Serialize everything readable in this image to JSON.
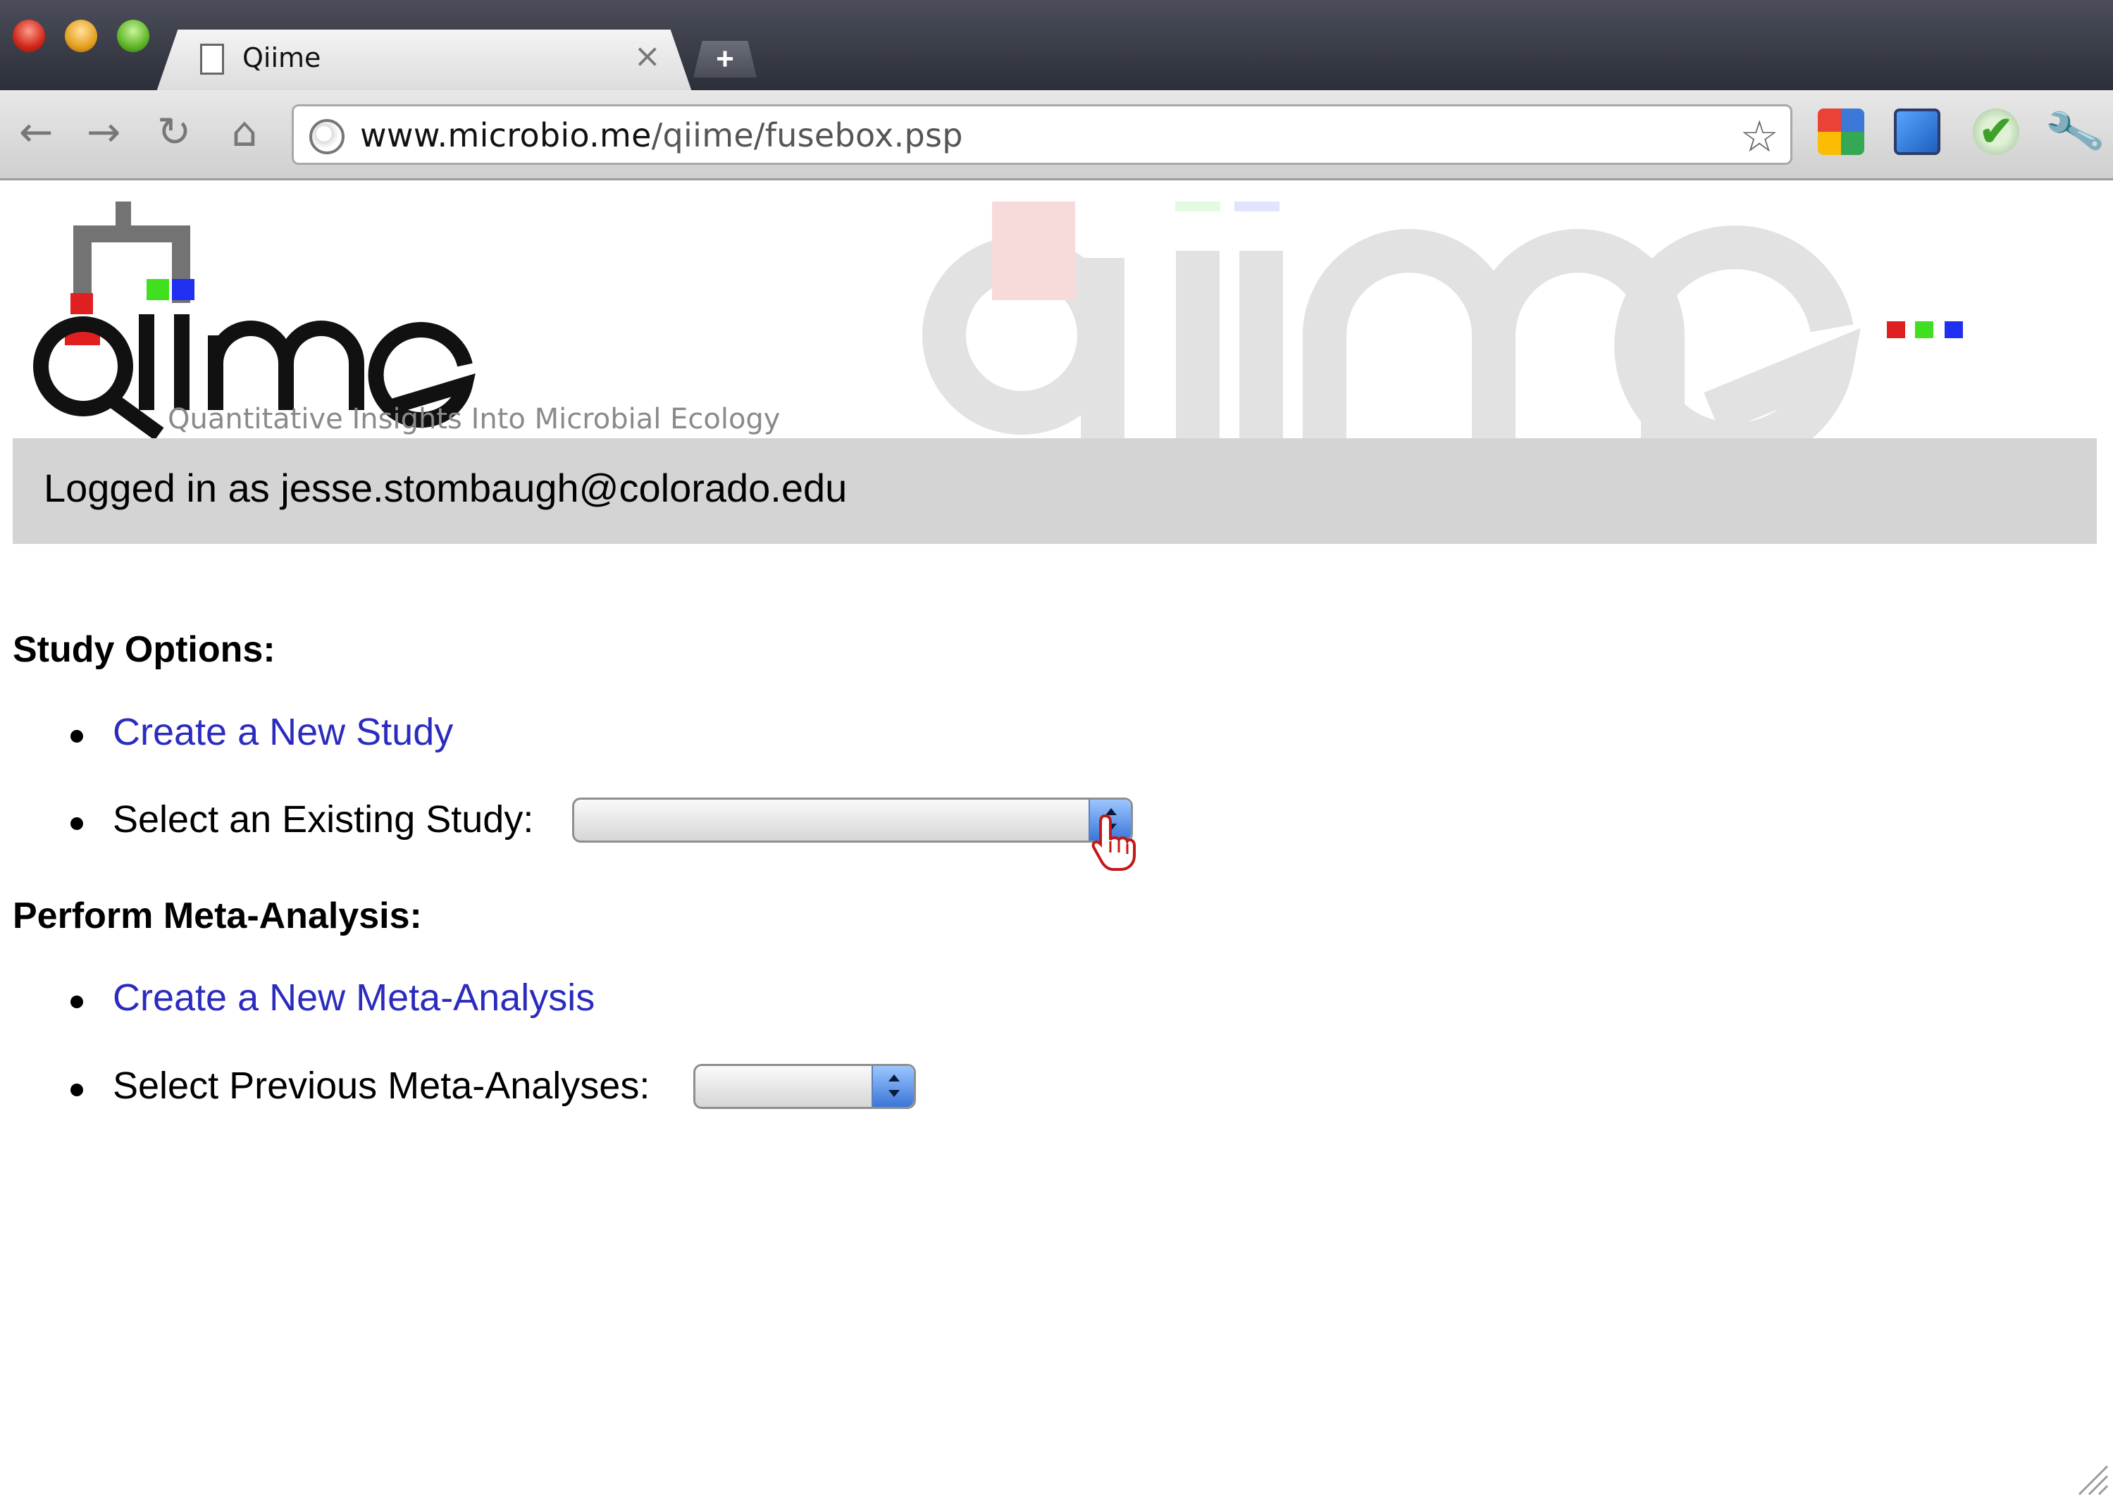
{
  "browser": {
    "tab_title": "Qiime",
    "tab_close": "×",
    "new_tab": "+",
    "url_domain": "www.microbio.me",
    "url_path": "/qiime/fusebox.psp",
    "nav": {
      "back": "←",
      "forward": "→",
      "reload": "↻",
      "home": "⌂"
    },
    "star": "☆",
    "wrench": "🔧"
  },
  "header": {
    "logo_text": "qiime",
    "tagline": "Quantitative Insights Into Microbial Ecology",
    "brand_colors": {
      "red": "#e02020",
      "green": "#40e020",
      "blue": "#2030f0",
      "gray": "#737373"
    }
  },
  "login": {
    "text": "Logged in as jesse.stombaugh@colorado.edu"
  },
  "study_options": {
    "heading": "Study Options:",
    "create_link": "Create a New Study",
    "select_label": "Select an Existing Study:",
    "select_value": ""
  },
  "meta_analysis": {
    "heading": "Perform Meta-Analysis:",
    "create_link": "Create a New Meta-Analysis",
    "select_label": "Select Previous Meta-Analyses:",
    "select_value": ""
  },
  "icons": {
    "page": "page-icon",
    "globe": "globe-icon",
    "star": "star-icon",
    "wrench": "wrench-icon",
    "cursor": "hand-pointer-icon"
  }
}
